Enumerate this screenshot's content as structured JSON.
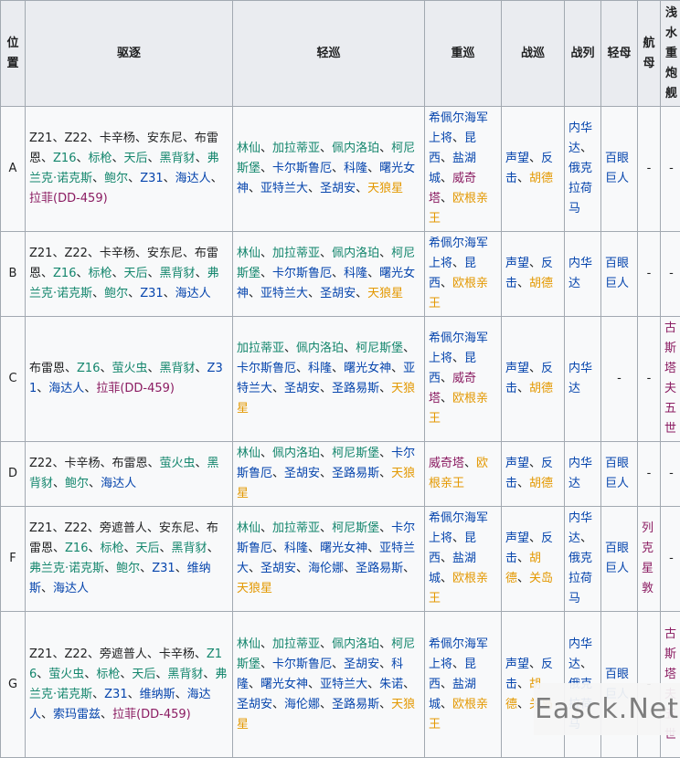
{
  "headers": {
    "pos": "位置",
    "dd": "驱逐",
    "cl": "轻巡",
    "ca": "重巡",
    "bc": "战巡",
    "bb": "战列",
    "cvl": "轻母",
    "cv": "航母",
    "ssv": "浅水重炮舰"
  },
  "rows": [
    {
      "pos": "A",
      "dd": [
        [
          "Z21、Z22、卡辛杨、安东尼、布雷恩、",
          "black"
        ],
        [
          "Z16",
          "green"
        ],
        [
          "、",
          "black"
        ],
        [
          "标枪",
          "green"
        ],
        [
          "、",
          "black"
        ],
        [
          "天后",
          "green"
        ],
        [
          "、",
          "black"
        ],
        [
          "黑背豺",
          "green"
        ],
        [
          "、",
          "black"
        ],
        [
          "弗兰克·诺克斯",
          "green"
        ],
        [
          "、",
          "black"
        ],
        [
          "鲍尔",
          "green"
        ],
        [
          "、",
          "black"
        ],
        [
          "Z31",
          "blue"
        ],
        [
          "、",
          "black"
        ],
        [
          "海达人",
          "blue"
        ],
        [
          "、",
          "black"
        ],
        [
          "拉菲(DD-459)",
          "purple"
        ]
      ],
      "cl": [
        [
          "林仙",
          "green"
        ],
        [
          "、",
          "black"
        ],
        [
          "加拉蒂亚",
          "green"
        ],
        [
          "、",
          "black"
        ],
        [
          "佩内洛珀",
          "green"
        ],
        [
          "、",
          "black"
        ],
        [
          "柯尼斯堡",
          "green"
        ],
        [
          "、",
          "black"
        ],
        [
          "卡尔斯鲁厄",
          "blue"
        ],
        [
          "、",
          "black"
        ],
        [
          "科隆",
          "blue"
        ],
        [
          "、",
          "black"
        ],
        [
          "曙光女神",
          "blue"
        ],
        [
          "、",
          "black"
        ],
        [
          "亚特兰大",
          "blue"
        ],
        [
          "、",
          "black"
        ],
        [
          "圣胡安",
          "blue"
        ],
        [
          "、",
          "black"
        ],
        [
          "天狼星",
          "orange"
        ]
      ],
      "ca": [
        [
          "希佩尔海军上将",
          "blue"
        ],
        [
          "、",
          "black"
        ],
        [
          "昆西",
          "blue"
        ],
        [
          "、",
          "black"
        ],
        [
          "盐湖城",
          "blue"
        ],
        [
          "、",
          "black"
        ],
        [
          "威奇塔",
          "purple"
        ],
        [
          "、",
          "black"
        ],
        [
          "欧根亲王",
          "orange"
        ]
      ],
      "bc": [
        [
          "声望",
          "blue"
        ],
        [
          "、",
          "black"
        ],
        [
          "反击",
          "blue"
        ],
        [
          "、",
          "black"
        ],
        [
          "胡德",
          "orange"
        ]
      ],
      "bb": [
        [
          "内华达",
          "blue"
        ],
        [
          "、",
          "black"
        ],
        [
          "俄克拉荷马",
          "blue"
        ]
      ],
      "cvl": [
        [
          "百眼巨人",
          "blue"
        ]
      ],
      "cv": [
        [
          "-",
          "black"
        ]
      ],
      "ssv": [
        [
          "-",
          "black"
        ]
      ]
    },
    {
      "pos": "B",
      "dd": [
        [
          "Z21、Z22、卡辛杨、安东尼、布雷恩、",
          "black"
        ],
        [
          "Z16",
          "green"
        ],
        [
          "、",
          "black"
        ],
        [
          "标枪",
          "green"
        ],
        [
          "、",
          "black"
        ],
        [
          "天后",
          "green"
        ],
        [
          "、",
          "black"
        ],
        [
          "黑背豺",
          "green"
        ],
        [
          "、",
          "black"
        ],
        [
          "弗兰克·诺克斯",
          "green"
        ],
        [
          "、",
          "black"
        ],
        [
          "鲍尔",
          "green"
        ],
        [
          "、",
          "black"
        ],
        [
          "Z31",
          "blue"
        ],
        [
          "、",
          "black"
        ],
        [
          "海达人",
          "blue"
        ]
      ],
      "cl": [
        [
          "林仙",
          "green"
        ],
        [
          "、",
          "black"
        ],
        [
          "加拉蒂亚",
          "green"
        ],
        [
          "、",
          "black"
        ],
        [
          "佩内洛珀",
          "green"
        ],
        [
          "、",
          "black"
        ],
        [
          "柯尼斯堡",
          "green"
        ],
        [
          "、",
          "black"
        ],
        [
          "卡尔斯鲁厄",
          "blue"
        ],
        [
          "、",
          "black"
        ],
        [
          "科隆",
          "blue"
        ],
        [
          "、",
          "black"
        ],
        [
          "曙光女神",
          "blue"
        ],
        [
          "、",
          "black"
        ],
        [
          "亚特兰大",
          "blue"
        ],
        [
          "、",
          "black"
        ],
        [
          "圣胡安",
          "blue"
        ],
        [
          "、",
          "black"
        ],
        [
          "天狼星",
          "orange"
        ]
      ],
      "ca": [
        [
          "希佩尔海军上将",
          "blue"
        ],
        [
          "、",
          "black"
        ],
        [
          "昆西",
          "blue"
        ],
        [
          "、",
          "black"
        ],
        [
          "欧根亲王",
          "orange"
        ]
      ],
      "bc": [
        [
          "声望",
          "blue"
        ],
        [
          "、",
          "black"
        ],
        [
          "反击",
          "blue"
        ],
        [
          "、",
          "black"
        ],
        [
          "胡德",
          "orange"
        ]
      ],
      "bb": [
        [
          "内华达",
          "blue"
        ]
      ],
      "cvl": [
        [
          "百眼巨人",
          "blue"
        ]
      ],
      "cv": [
        [
          "-",
          "black"
        ]
      ],
      "ssv": [
        [
          "-",
          "black"
        ]
      ]
    },
    {
      "pos": "C",
      "dd": [
        [
          "布雷恩、",
          "black"
        ],
        [
          "Z16",
          "green"
        ],
        [
          "、",
          "black"
        ],
        [
          "萤火虫",
          "green"
        ],
        [
          "、",
          "black"
        ],
        [
          "黑背豺",
          "green"
        ],
        [
          "、",
          "black"
        ],
        [
          "Z31",
          "blue"
        ],
        [
          "、",
          "black"
        ],
        [
          "海达人",
          "blue"
        ],
        [
          "、",
          "black"
        ],
        [
          "拉菲(DD-459)",
          "purple"
        ]
      ],
      "cl": [
        [
          "加拉蒂亚",
          "green"
        ],
        [
          "、",
          "black"
        ],
        [
          "佩内洛珀",
          "green"
        ],
        [
          "、",
          "black"
        ],
        [
          "柯尼斯堡",
          "green"
        ],
        [
          "、",
          "black"
        ],
        [
          "卡尔斯鲁厄",
          "blue"
        ],
        [
          "、",
          "black"
        ],
        [
          "科隆",
          "blue"
        ],
        [
          "、",
          "black"
        ],
        [
          "曙光女神",
          "blue"
        ],
        [
          "、",
          "black"
        ],
        [
          "亚特兰大",
          "blue"
        ],
        [
          "、",
          "black"
        ],
        [
          "圣胡安",
          "blue"
        ],
        [
          "、",
          "black"
        ],
        [
          "圣路易斯",
          "blue"
        ],
        [
          "、",
          "black"
        ],
        [
          "天狼星",
          "orange"
        ]
      ],
      "ca": [
        [
          "希佩尔海军上将",
          "blue"
        ],
        [
          "、",
          "black"
        ],
        [
          "昆西",
          "blue"
        ],
        [
          "、",
          "black"
        ],
        [
          "威奇塔",
          "purple"
        ],
        [
          "、",
          "black"
        ],
        [
          "欧根亲王",
          "orange"
        ]
      ],
      "bc": [
        [
          "声望",
          "blue"
        ],
        [
          "、",
          "black"
        ],
        [
          "反击",
          "blue"
        ],
        [
          "、",
          "black"
        ],
        [
          "胡德",
          "orange"
        ]
      ],
      "bb": [
        [
          "内华达",
          "blue"
        ]
      ],
      "cvl": [
        [
          "-",
          "black"
        ]
      ],
      "cv": [
        [
          "-",
          "black"
        ]
      ],
      "ssv": [
        [
          "古斯塔夫五世",
          "purple"
        ]
      ]
    },
    {
      "pos": "D",
      "dd": [
        [
          "Z22、卡辛杨、布雷恩、",
          "black"
        ],
        [
          "萤火虫",
          "green"
        ],
        [
          "、",
          "black"
        ],
        [
          "黑背豺",
          "green"
        ],
        [
          "、",
          "black"
        ],
        [
          "鲍尔",
          "green"
        ],
        [
          "、",
          "black"
        ],
        [
          "海达人",
          "blue"
        ]
      ],
      "cl": [
        [
          "林仙",
          "green"
        ],
        [
          "、",
          "black"
        ],
        [
          "佩内洛珀",
          "green"
        ],
        [
          "、",
          "black"
        ],
        [
          "柯尼斯堡",
          "green"
        ],
        [
          "、",
          "black"
        ],
        [
          "卡尔斯鲁厄",
          "blue"
        ],
        [
          "、",
          "black"
        ],
        [
          "圣胡安",
          "blue"
        ],
        [
          "、",
          "black"
        ],
        [
          "圣路易斯",
          "blue"
        ],
        [
          "、",
          "black"
        ],
        [
          "天狼星",
          "orange"
        ]
      ],
      "ca": [
        [
          "威奇塔",
          "purple"
        ],
        [
          "、",
          "black"
        ],
        [
          "欧根亲王",
          "orange"
        ]
      ],
      "bc": [
        [
          "声望",
          "blue"
        ],
        [
          "、",
          "black"
        ],
        [
          "反击",
          "blue"
        ],
        [
          "、",
          "black"
        ],
        [
          "胡德",
          "orange"
        ]
      ],
      "bb": [
        [
          "内华达",
          "blue"
        ]
      ],
      "cvl": [
        [
          "百眼巨人",
          "blue"
        ]
      ],
      "cv": [
        [
          "-",
          "black"
        ]
      ],
      "ssv": [
        [
          "-",
          "black"
        ]
      ]
    },
    {
      "pos": "F",
      "dd": [
        [
          "Z21、Z22、旁遮普人、安东尼、布雷恩、",
          "black"
        ],
        [
          "Z16",
          "green"
        ],
        [
          "、",
          "black"
        ],
        [
          "标枪",
          "green"
        ],
        [
          "、",
          "black"
        ],
        [
          "天后",
          "green"
        ],
        [
          "、",
          "black"
        ],
        [
          "黑背豺",
          "green"
        ],
        [
          "、",
          "black"
        ],
        [
          "弗兰克·诺克斯",
          "green"
        ],
        [
          "、",
          "black"
        ],
        [
          "鲍尔",
          "green"
        ],
        [
          "、",
          "black"
        ],
        [
          "Z31",
          "blue"
        ],
        [
          "、",
          "black"
        ],
        [
          "维纳斯",
          "blue"
        ],
        [
          "、",
          "black"
        ],
        [
          "海达人",
          "blue"
        ]
      ],
      "cl": [
        [
          "林仙",
          "green"
        ],
        [
          "、",
          "black"
        ],
        [
          "加拉蒂亚",
          "green"
        ],
        [
          "、",
          "black"
        ],
        [
          "柯尼斯堡",
          "green"
        ],
        [
          "、",
          "black"
        ],
        [
          "卡尔斯鲁厄",
          "blue"
        ],
        [
          "、",
          "black"
        ],
        [
          "科隆",
          "blue"
        ],
        [
          "、",
          "black"
        ],
        [
          "曙光女神",
          "blue"
        ],
        [
          "、",
          "black"
        ],
        [
          "亚特兰大",
          "blue"
        ],
        [
          "、",
          "black"
        ],
        [
          "圣胡安",
          "blue"
        ],
        [
          "、",
          "black"
        ],
        [
          "海伦娜",
          "blue"
        ],
        [
          "、",
          "black"
        ],
        [
          "圣路易斯",
          "blue"
        ],
        [
          "、",
          "black"
        ],
        [
          "天狼星",
          "orange"
        ]
      ],
      "ca": [
        [
          "希佩尔海军上将",
          "blue"
        ],
        [
          "、",
          "black"
        ],
        [
          "昆西",
          "blue"
        ],
        [
          "、",
          "black"
        ],
        [
          "盐湖城",
          "blue"
        ],
        [
          "、",
          "black"
        ],
        [
          "欧根亲王",
          "orange"
        ]
      ],
      "bc": [
        [
          "声望",
          "blue"
        ],
        [
          "、",
          "black"
        ],
        [
          "反击",
          "blue"
        ],
        [
          "、",
          "black"
        ],
        [
          "胡德",
          "orange"
        ],
        [
          "、",
          "black"
        ],
        [
          "关岛",
          "orange"
        ]
      ],
      "bb": [
        [
          "内华达",
          "blue"
        ],
        [
          "、",
          "black"
        ],
        [
          "俄克拉荷马",
          "blue"
        ]
      ],
      "cvl": [
        [
          "百眼巨人",
          "blue"
        ]
      ],
      "cv": [
        [
          "列克星敦",
          "purple"
        ]
      ],
      "ssv": [
        [
          "-",
          "black"
        ]
      ]
    },
    {
      "pos": "G",
      "dd": [
        [
          "Z21、Z22、旁遮普人、卡辛杨、",
          "black"
        ],
        [
          "Z16",
          "green"
        ],
        [
          "、",
          "black"
        ],
        [
          "萤火虫",
          "green"
        ],
        [
          "、",
          "black"
        ],
        [
          "标枪",
          "green"
        ],
        [
          "、",
          "black"
        ],
        [
          "天后",
          "green"
        ],
        [
          "、",
          "black"
        ],
        [
          "黑背豺",
          "green"
        ],
        [
          "、",
          "black"
        ],
        [
          "弗兰克·诺克斯",
          "green"
        ],
        [
          "、",
          "black"
        ],
        [
          "Z31",
          "blue"
        ],
        [
          "、",
          "black"
        ],
        [
          "维纳斯",
          "blue"
        ],
        [
          "、",
          "black"
        ],
        [
          "海达人",
          "blue"
        ],
        [
          "、",
          "black"
        ],
        [
          "索玛雷兹",
          "blue"
        ],
        [
          "、",
          "black"
        ],
        [
          "拉菲(DD-459)",
          "purple"
        ]
      ],
      "cl": [
        [
          "林仙",
          "green"
        ],
        [
          "、",
          "black"
        ],
        [
          "加拉蒂亚",
          "green"
        ],
        [
          "、",
          "black"
        ],
        [
          "佩内洛珀",
          "green"
        ],
        [
          "、",
          "black"
        ],
        [
          "柯尼斯堡",
          "green"
        ],
        [
          "、",
          "black"
        ],
        [
          "卡尔斯鲁厄",
          "blue"
        ],
        [
          "、",
          "black"
        ],
        [
          "圣胡安",
          "blue"
        ],
        [
          "、",
          "black"
        ],
        [
          "科隆",
          "blue"
        ],
        [
          "、",
          "black"
        ],
        [
          "曙光女神",
          "blue"
        ],
        [
          "、",
          "black"
        ],
        [
          "亚特兰大",
          "blue"
        ],
        [
          "、",
          "black"
        ],
        [
          "朱诺",
          "blue"
        ],
        [
          "、",
          "black"
        ],
        [
          "圣胡安",
          "blue"
        ],
        [
          "、",
          "black"
        ],
        [
          "海伦娜",
          "blue"
        ],
        [
          "、",
          "black"
        ],
        [
          "圣路易斯",
          "blue"
        ],
        [
          "、",
          "black"
        ],
        [
          "天狼星",
          "orange"
        ]
      ],
      "ca": [
        [
          "希佩尔海军上将",
          "blue"
        ],
        [
          "、",
          "black"
        ],
        [
          "昆西",
          "blue"
        ],
        [
          "、",
          "black"
        ],
        [
          "盐湖城",
          "blue"
        ],
        [
          "、",
          "black"
        ],
        [
          "欧根亲王",
          "orange"
        ]
      ],
      "bc": [
        [
          "声望",
          "blue"
        ],
        [
          "、",
          "black"
        ],
        [
          "反击",
          "blue"
        ],
        [
          "、",
          "black"
        ],
        [
          "胡德",
          "orange"
        ],
        [
          "、",
          "black"
        ],
        [
          "关岛",
          "orange"
        ]
      ],
      "bb": [
        [
          "内华达",
          "blue"
        ],
        [
          "、",
          "black"
        ],
        [
          "俄克拉荷马",
          "blue"
        ]
      ],
      "cvl": [
        [
          "百眼巨人",
          "blue"
        ]
      ],
      "cv": [
        [
          "-",
          "black"
        ]
      ],
      "ssv": [
        [
          "古斯塔夫五世",
          "purple"
        ]
      ]
    }
  ],
  "watermark": "Easck.Net"
}
